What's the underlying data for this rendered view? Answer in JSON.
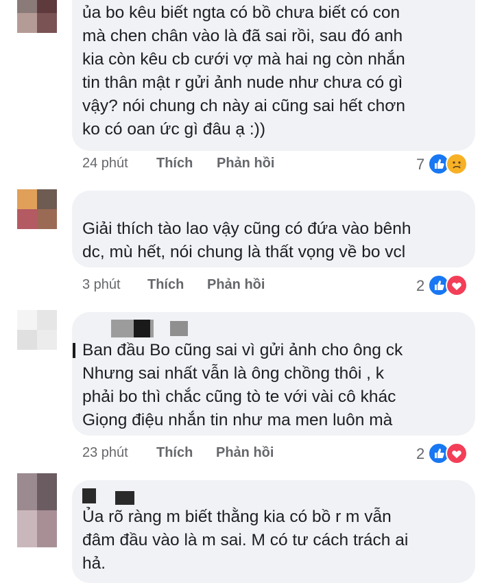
{
  "comments": [
    {
      "lines": [
        "ủa bo kêu biết ngta có bồ chưa biết có con",
        "mà chen chân vào là đã sai rồi, sau đó anh",
        "kia còn kêu cb cưới vợ mà hai ng còn nhắn",
        "tin thân mật r gửi ảnh nude như chưa có gì",
        "vậy? nói chung ch này ai cũng sai hết chơn",
        "ko có oan ức gì đâu ạ :))"
      ],
      "time": "24 phút",
      "like_label": "Thích",
      "reply_label": "Phản hồi",
      "reaction_count": "7",
      "reactions": [
        "like-icon",
        "sad-icon"
      ]
    },
    {
      "lines": [
        "Giải thích tào lao vậy cũng có đứa vào bênh",
        "dc, mù hết, nói chung là thất vọng về bo vcl"
      ],
      "time": "3 phút",
      "like_label": "Thích",
      "reply_label": "Phản hồi",
      "reaction_count": "2",
      "reactions": [
        "like-icon",
        "love-icon"
      ]
    },
    {
      "lines": [
        "Ban đầu Bo cũng sai vì gửi ảnh cho ông ck",
        "Nhưng sai nhất vẫn là ông chồng thôi , k",
        "phải bo thì chắc cũng tò te với vài cô khác",
        "Giọng điệu nhắn tin như ma men luôn mà"
      ],
      "time": "23 phút",
      "like_label": "Thích",
      "reply_label": "Phản hồi",
      "reaction_count": "2",
      "reactions": [
        "like-icon",
        "love-icon"
      ]
    },
    {
      "lines": [
        "Ủa rõ ràng m biết thằng kia có bồ r m vẫn",
        "đâm đầu vào là m sai. M có tư cách trách ai",
        "hả."
      ]
    }
  ],
  "colors": {
    "like_blue": "#1877f2",
    "love_red": "#f33e58",
    "sad_yellow": "#f7b125",
    "bubble_bg": "#f0f2f5",
    "meta_gray": "#65676b"
  }
}
